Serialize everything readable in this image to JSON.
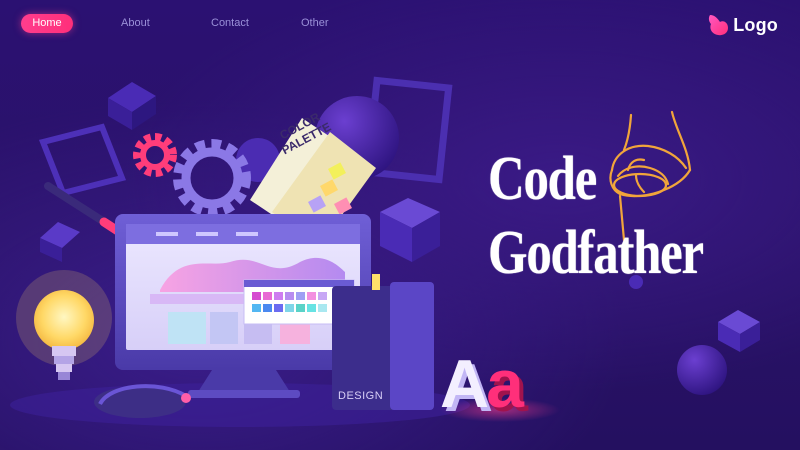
{
  "nav": {
    "items": [
      {
        "label": "Home",
        "active": true
      },
      {
        "label": "About",
        "active": false
      },
      {
        "label": "Contact",
        "active": false
      },
      {
        "label": "Other",
        "active": false
      }
    ]
  },
  "logo": {
    "text": "Logo"
  },
  "hero": {
    "title_line1": "Code",
    "title_line2": "Godfather",
    "palette_line1": "COLOR",
    "palette_line2": "PALETTE",
    "book_label": "DESIGN",
    "aa_first": "A",
    "aa_second": "a"
  },
  "colors": {
    "background": "#2a1268",
    "accent": "#ff2f7a",
    "nav_text": "#9a90d8",
    "title": "#ffffff",
    "hand_outline": "#f1a53b"
  },
  "icons": [
    "logo-mark-icon",
    "gear-icon",
    "lightbulb-icon",
    "pen-icon",
    "hand-icon",
    "mouse-icon"
  ]
}
